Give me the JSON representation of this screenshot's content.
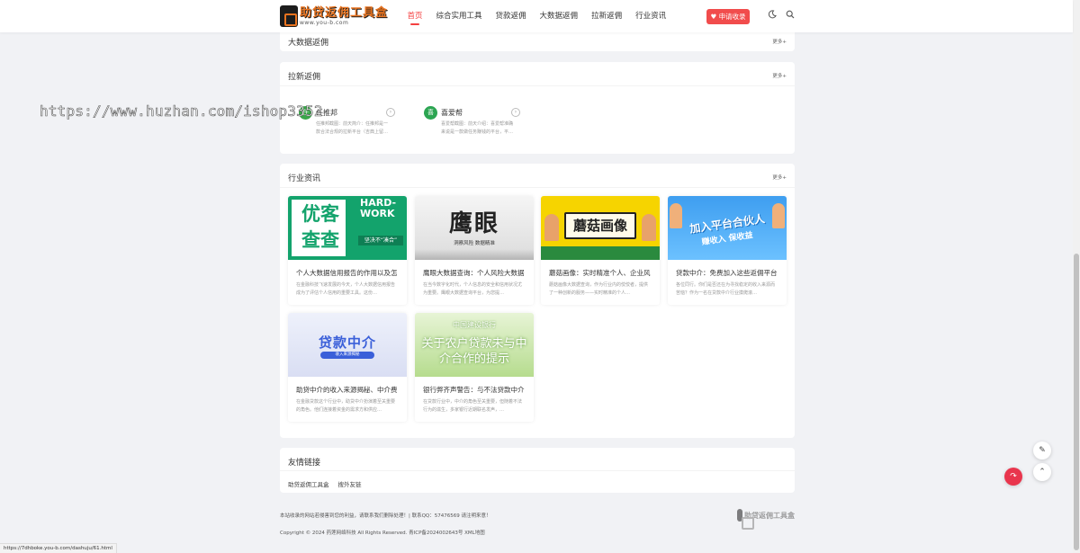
{
  "header": {
    "logo_title": "助贷返佣工具盒",
    "logo_sub": "www.you-b.com",
    "nav": [
      "首页",
      "综合实用工具",
      "贷款返佣",
      "大数据返佣",
      "拉新返佣",
      "行业资讯"
    ],
    "apply_label": "申请收录",
    "icons": [
      "moon-icon",
      "search-icon"
    ]
  },
  "bigdata": {
    "title": "大数据返佣",
    "more": "更多+"
  },
  "laxin": {
    "title": "拉新返佣",
    "more": "更多+",
    "items": [
      {
        "name": "任推邦",
        "desc": "任推邦截图：前天简介：任推邦是一款合法合规的拉新平台（吉典上留…",
        "color": "#3aa64a"
      },
      {
        "name": "喜爱帮",
        "desc": "喜爱帮截图：前天介绍：喜爱帮准确来说是一款做任务赚钱的平台，平…",
        "color": "#2ca552"
      }
    ]
  },
  "news": {
    "title": "行业资讯",
    "more": "更多+",
    "items": [
      {
        "title": "个人大数据信用报告的作用以及怎",
        "desc": "在金融科技飞速发展的今天，个人大数据信用报告成为了评估个人信用的重要工具。这份…",
        "thumb_text": "优客查查",
        "thumb_sub": "HARD-WORK",
        "thumb_tag": "坚决不“凑合”"
      },
      {
        "title": "鹰眼大数据查询：个人风险大数据",
        "desc": "在当今数字化时代，个人信息的安全和信用状况尤为重要。鹰眼大数据查询平台，为您提…",
        "thumb_text": "鹰眼",
        "thumb_sub": "洞察风险 数据精准"
      },
      {
        "title": "蘑菇画像：实时精准个人、企业风",
        "desc": "蘑菇画像大数据查询，作为行业内的佼佼者，提供了一种创新的服务——实时精准的个人…",
        "thumb_text": "蘑菇画像"
      },
      {
        "title": "贷款中介：免费加入这些返佣平台",
        "desc": "各位同行。你们是否还在为寻找稳定的收入来源而苦恼？作为一名在贷款中介行业摸爬滚…",
        "thumb_text": "加入平台合伙人",
        "thumb_sub": "赚收入 保收益"
      },
      {
        "title": "助贷中介的收入来源揭秘、中介费",
        "desc": "在金融贷款这个行业中，助贷中介扮演着至关重要的角色。他们连接着资金的需求方和供应…",
        "thumb_text": "贷款中介",
        "thumb_sub": "收入来源揭秘"
      },
      {
        "title": "银行弊齐声警告：与不法贷款中介",
        "desc": "在贷款行业中，中介的角色至关重要，但随着不法行为的滋生，多家银行近期联名发声，…",
        "thumb_text": "关于农户贷款未与中介合作的提示",
        "thumb_sub": "中国建设银行"
      }
    ]
  },
  "links": {
    "title": "友情链接",
    "items": [
      "助贷返佣工具盒",
      "搜外友链"
    ]
  },
  "footer": {
    "notice": "本站收录的网站若侵害到您的利益，请联系我们删除处理！| 联系QQ：57476569 请注明来意！",
    "copyright": "Copyright © 2024 药莲网络科技 All Rights Reserved. 青ICP备2024002643号 XML地图"
  },
  "watermark": "https://www.huzhan.com/ishop3352",
  "status_url": "https://7dhboke.you-b.com/dashuju/61.html",
  "colors": {
    "accent": "#f44040",
    "apply": "#f14c4c",
    "float_red": "#e9354d"
  }
}
